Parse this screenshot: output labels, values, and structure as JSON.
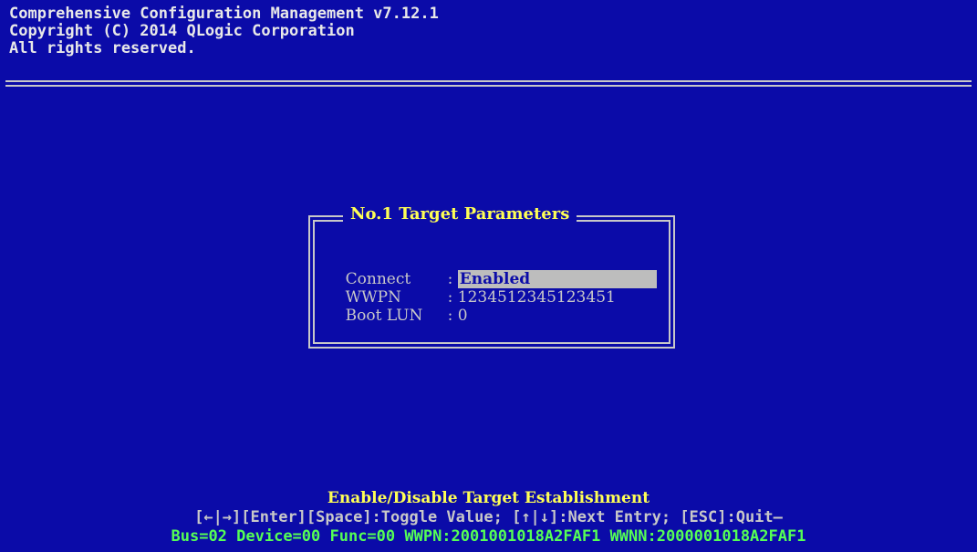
{
  "header": {
    "line1": "Comprehensive Configuration Management v7.12.1",
    "line2": "Copyright (C) 2014 QLogic Corporation",
    "line3": "All rights reserved."
  },
  "dialog": {
    "title": "No.1 Target Parameters",
    "fields": [
      {
        "label": "Connect",
        "sep": ":",
        "value": "Enabled"
      },
      {
        "label": "WWPN",
        "sep": ":",
        "value": "1234512345123451"
      },
      {
        "label": "Boot LUN",
        "sep": ":",
        "value": "0"
      }
    ]
  },
  "footer": {
    "help_title": "Enable/Disable Target Establishment",
    "keys": "[←|→][Enter][Space]:Toggle Value; [↑|↓]:Next Entry; [ESC]:Quit–",
    "status": "Bus=02 Device=00 Func=00 WWPN:2001001018A2FAF1 WWNN:2000001018A2FAF1"
  },
  "colors": {
    "background": "#0b0ba8",
    "title_yellow": "#ffff55",
    "status_green": "#55ff55",
    "text_gray": "#c8c8c8",
    "selection": "#bdbdbd"
  }
}
